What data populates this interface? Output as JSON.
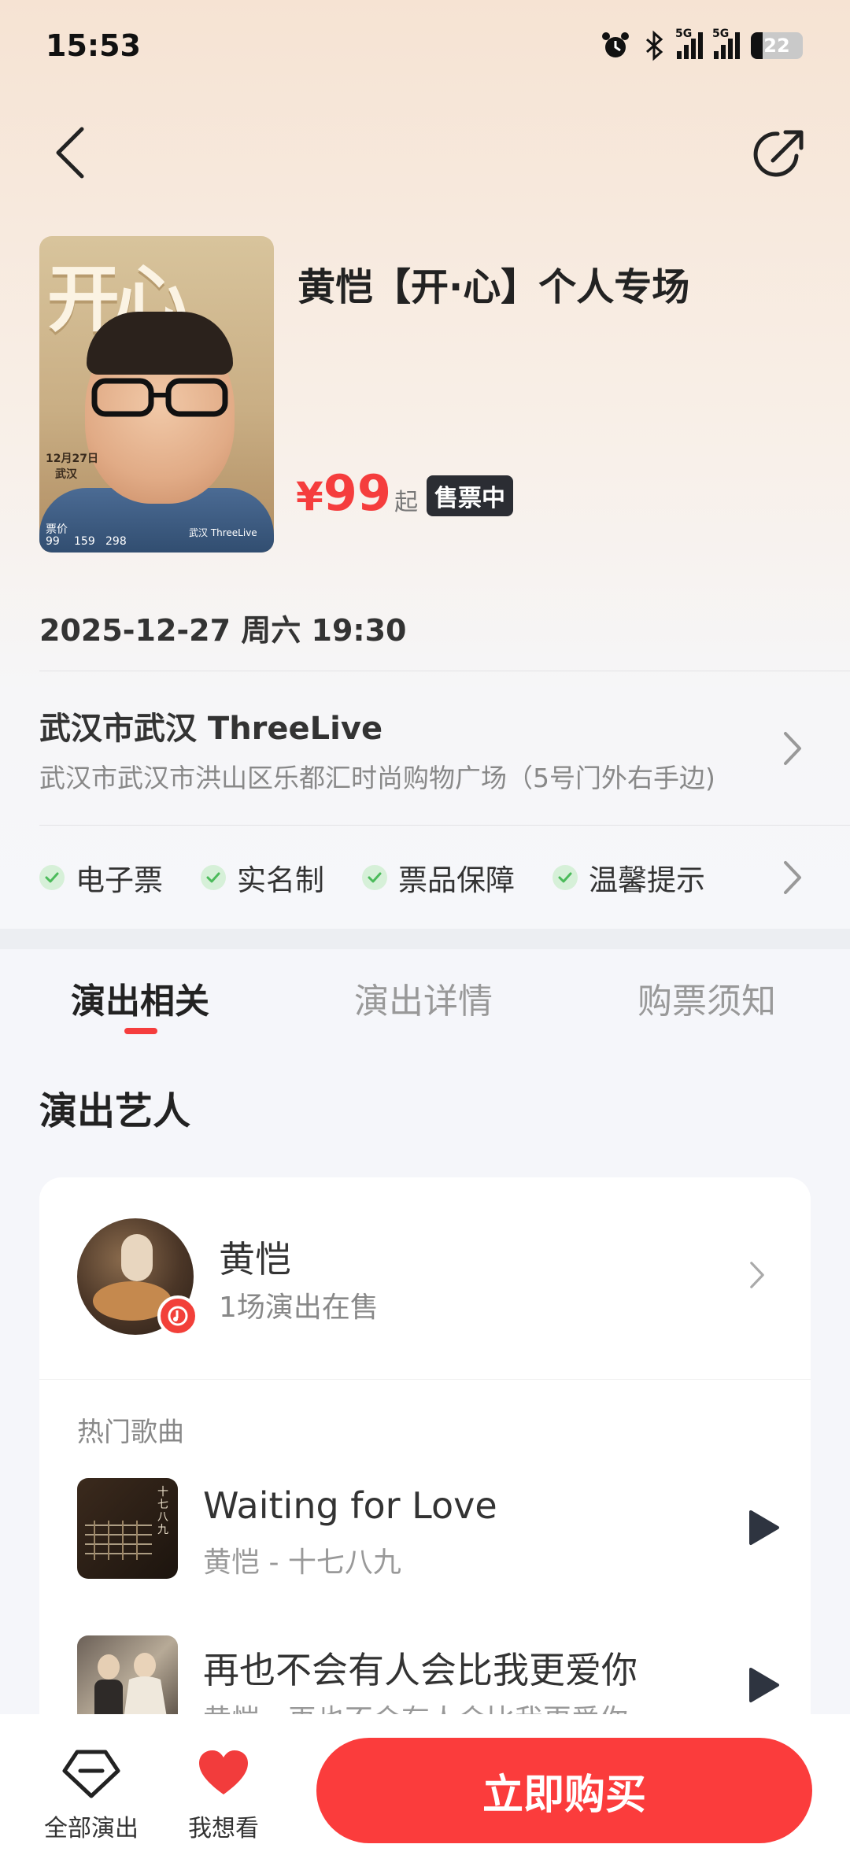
{
  "status_bar": {
    "time": "15:53",
    "network_1": "5G",
    "network_2": "5G",
    "battery": "22",
    "battery_fraction": 0.22
  },
  "colors": {
    "accent": "#fb3c3c",
    "price": "#f53d3d",
    "check": "#4cbb5b",
    "dark": "#2b2d33"
  },
  "poster": {
    "title": "开心",
    "date_text": "12月27日",
    "city_text": "武汉",
    "price_label": "票价",
    "prices": [
      "99",
      "159",
      "298"
    ],
    "venue_text": "武汉 ThreeLive"
  },
  "event": {
    "title": "黄恺【开·心】个人专场",
    "currency": "¥",
    "price": "99",
    "price_suffix": "起",
    "status_badge": "售票中"
  },
  "datetime": "2025-12-27 周六 19:30",
  "venue": {
    "name": "武汉市武汉 ThreeLive",
    "address": "武汉市武汉市洪山区乐都汇时尚购物广场（5号门外右手边)"
  },
  "features": [
    "电子票",
    "实名制",
    "票品保障",
    "温馨提示"
  ],
  "tabs": [
    {
      "label": "演出相关",
      "active": true
    },
    {
      "label": "演出详情",
      "active": false
    },
    {
      "label": "购票须知",
      "active": false
    }
  ],
  "artists_section": {
    "title": "演出艺人",
    "artist": {
      "name": "黄恺",
      "subtitle": "1场演出在售"
    },
    "hot_songs_label": "热门歌曲",
    "songs": [
      {
        "title": "Waiting for Love",
        "subtitle": "黄恺 - 十七八九",
        "cover_text": "十七八九"
      },
      {
        "title": "再也不会有人会比我更爱你",
        "subtitle": "黄恺 - 再也不会有人会比我更爱你"
      }
    ]
  },
  "bottom_bar": {
    "all_shows": "全部演出",
    "want_to_see": "我想看",
    "buy_now": "立即购买"
  }
}
